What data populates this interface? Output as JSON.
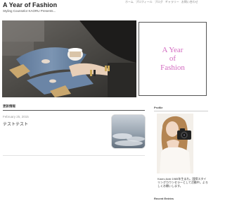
{
  "header": {
    "title": "A Year of Fashion",
    "tagline": "Styling Counselor KAORU Presents...",
    "nav": [
      "ホーム",
      "プロフィール",
      "ブログ",
      "ギャラリー",
      "お問い合わせ"
    ]
  },
  "title_box": {
    "text": "A Year\nof\nFashion",
    "color": "#d36bc1"
  },
  "main": {
    "section_header": "更新情報",
    "post": {
      "date": "February 25, 2015",
      "title": "テストテスト"
    }
  },
  "sidebar": {
    "profile_header": "Profile",
    "profile_bio": "Kaoru Aoki 1985年生まれ。国際スタイリングカウンセラーとして活動中。よろしくお願いします。",
    "recent_header": "Recent Entries"
  },
  "icons": [
    "camera-icon"
  ]
}
